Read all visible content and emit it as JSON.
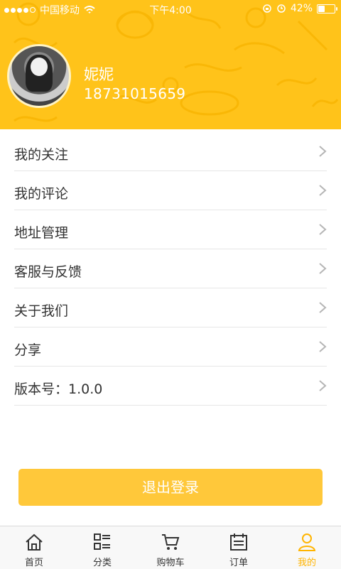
{
  "status_bar": {
    "carrier": "中国移动",
    "time": "下午4:00",
    "battery": "42%",
    "battery_level": 0.42
  },
  "profile": {
    "name": "妮妮",
    "phone": "18731015659"
  },
  "menu": {
    "items": [
      {
        "label": "我的关注"
      },
      {
        "label": "我的评论"
      },
      {
        "label": "地址管理"
      },
      {
        "label": "客服与反馈"
      },
      {
        "label": "关于我们"
      },
      {
        "label": "分享"
      },
      {
        "label": "版本号：1.0.0"
      }
    ]
  },
  "logout_label": "退出登录",
  "tabbar": {
    "tabs": [
      {
        "label": "首页",
        "icon": "home-icon"
      },
      {
        "label": "分类",
        "icon": "category-icon"
      },
      {
        "label": "购物车",
        "icon": "cart-icon"
      },
      {
        "label": "订单",
        "icon": "order-icon"
      },
      {
        "label": "我的",
        "icon": "user-icon"
      }
    ],
    "active": "我的"
  },
  "colors": {
    "accent": "#ffc31a",
    "button": "#ffc83a",
    "active_tab": "#ffb400"
  }
}
